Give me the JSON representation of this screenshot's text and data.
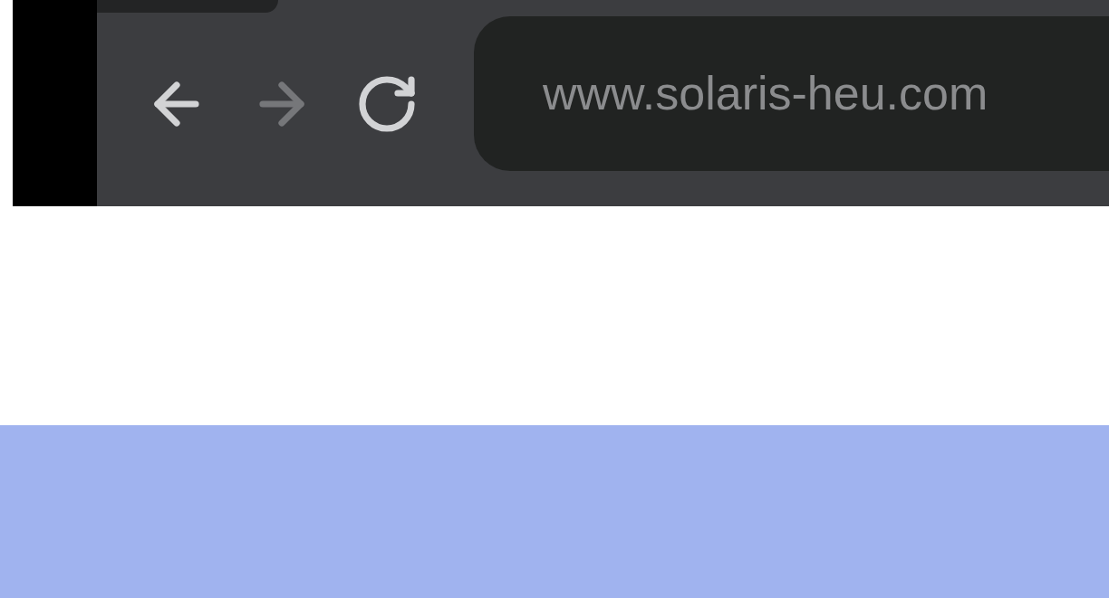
{
  "toolbar": {
    "buttons": [
      {
        "kind": "back",
        "disabled": false
      },
      {
        "kind": "forward",
        "disabled": true
      },
      {
        "kind": "reload",
        "disabled": false
      }
    ],
    "address": "www.solaris-heu.com"
  }
}
